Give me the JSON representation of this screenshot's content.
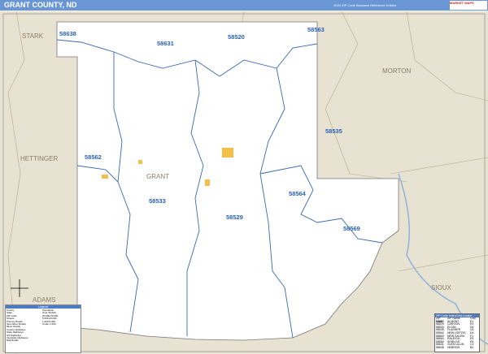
{
  "header": {
    "title": "GRANT COUNTY, ND",
    "edition": "2020 ZIP Code Business Reference Edition",
    "logo_text": "MARKET MAPS"
  },
  "counties": {
    "stark": "STARK",
    "hettinger": "HETTINGER",
    "morton": "MORTON",
    "sioux": "SIOUX",
    "grant": "GRANT",
    "adams": "ADAMS"
  },
  "zips": [
    "58638",
    "58631",
    "58520",
    "58563",
    "58535",
    "58562",
    "58533",
    "58529",
    "58564",
    "58569"
  ],
  "legend": {
    "title": "Legend",
    "items": [
      "County",
      "State",
      "ZIP Code",
      "Streets",
      "Primary Roads",
      "Secondary Roads",
      "Minor Roads",
      "County Highways",
      "State Highways",
      "US Highways",
      "Interstate Highways",
      "Rail Roads"
    ],
    "pop_title": "Population",
    "pop_items": [
      "Over 50,000",
      "20,000-50,000",
      "5,000-20,000",
      "1,000-5,000",
      "Under 1,000"
    ]
  },
  "zip_table": {
    "title": "ZIP Code Index/Grid Locator",
    "headers": [
      "ZIP Code",
      "ZIP Name",
      "Grid"
    ],
    "rows": [
      [
        "58520",
        "ALMONT",
        "E1"
      ],
      [
        "58529",
        "CARSON",
        "E4"
      ],
      [
        "58533",
        "ELGIN",
        "D4"
      ],
      [
        "58535",
        "FLASHER",
        "C6"
      ],
      [
        "58562",
        "NEW LEIPZIG",
        "D4"
      ],
      [
        "58563",
        "NEW SALEM",
        "F1"
      ],
      [
        "58564",
        "RALEIGH",
        "E5"
      ],
      [
        "58569",
        "SHIELDS",
        "F6"
      ],
      [
        "58631",
        "GLEN ULLIN",
        "C1"
      ],
      [
        "58638",
        "HEBRON",
        "B1"
      ]
    ]
  },
  "colors": {
    "header": "#6a96d6",
    "zip_label": "#2a62b8",
    "land": "#e8e2d2",
    "county": "#ffffff",
    "boundary": "#3a68b0"
  }
}
